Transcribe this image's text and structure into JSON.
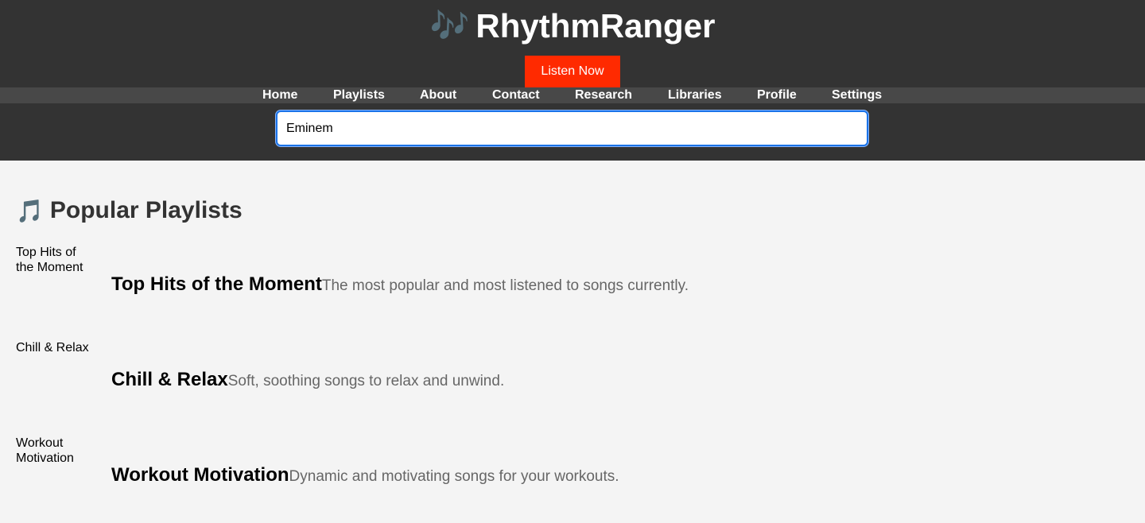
{
  "header": {
    "brand_icon": "🎶",
    "brand_title": "RhythmRanger",
    "listen_label": "Listen Now"
  },
  "nav": {
    "items": [
      "Home",
      "Playlists",
      "About",
      "Contact",
      "Research",
      "Libraries",
      "Profile",
      "Settings"
    ]
  },
  "search": {
    "value": "Eminem"
  },
  "section": {
    "icon": "🎵",
    "title": "Popular Playlists"
  },
  "playlists": [
    {
      "image_alt": "Top Hits of the Moment",
      "title": "Top Hits of the Moment",
      "description": "The most popular and most listened to songs currently."
    },
    {
      "image_alt": "Chill & Relax",
      "title": "Chill & Relax",
      "description": "Soft, soothing songs to relax and unwind."
    },
    {
      "image_alt": "Workout Motivation",
      "title": "Workout Motivation",
      "description": "Dynamic and motivating songs for your workouts."
    }
  ]
}
